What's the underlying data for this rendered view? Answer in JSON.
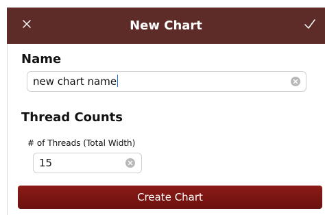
{
  "header": {
    "title": "New Chart",
    "close_icon": "close-icon",
    "confirm_icon": "checkmark-icon"
  },
  "name_section": {
    "title": "Name",
    "input_value": "new chart name",
    "clear_icon": "clear-circle-icon"
  },
  "thread_counts": {
    "title": "Thread Counts",
    "threads_label": "# of Threads (Total Width)",
    "threads_value": "15",
    "clear_icon": "clear-circle-icon"
  },
  "actions": {
    "create_label": "Create Chart"
  },
  "colors": {
    "header_bg": "#5e2c28",
    "button_bg": "#7b1612",
    "button_text": "#ffffff"
  }
}
